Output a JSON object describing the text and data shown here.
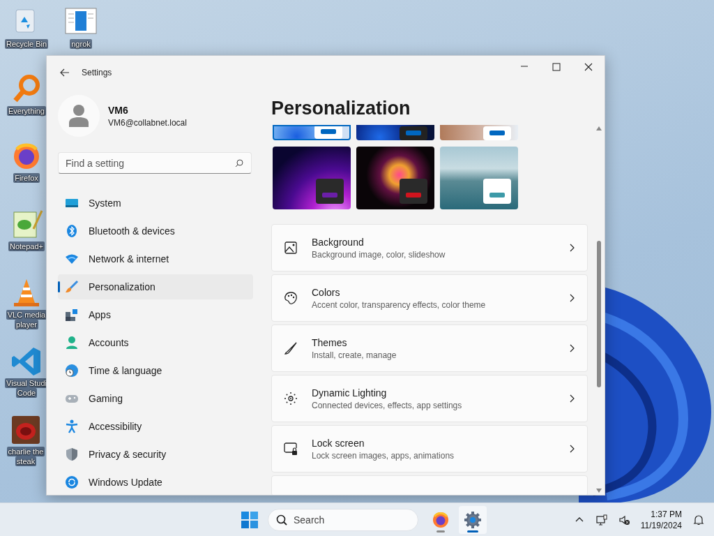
{
  "desktop_icons": [
    {
      "label": [
        "Recycle Bin"
      ]
    },
    {
      "label": [
        "ngrok"
      ]
    },
    {
      "label": [
        "Everything"
      ]
    },
    {
      "label": [
        "Firefox"
      ]
    },
    {
      "label": [
        "Notepad+"
      ]
    },
    {
      "label": [
        "VLC media",
        "player"
      ]
    },
    {
      "label": [
        "Visual Studi",
        "Code"
      ]
    },
    {
      "label": [
        "charlie the",
        "steak"
      ]
    }
  ],
  "window": {
    "title": "Settings"
  },
  "profile": {
    "name": "VM6",
    "email": "VM6@collabnet.local"
  },
  "search": {
    "placeholder": "Find a setting"
  },
  "sidebar": {
    "items": [
      {
        "label": "System",
        "selected": false
      },
      {
        "label": "Bluetooth & devices",
        "selected": false
      },
      {
        "label": "Network & internet",
        "selected": false
      },
      {
        "label": "Personalization",
        "selected": true
      },
      {
        "label": "Apps",
        "selected": false
      },
      {
        "label": "Accounts",
        "selected": false
      },
      {
        "label": "Time & language",
        "selected": false
      },
      {
        "label": "Gaming",
        "selected": false
      },
      {
        "label": "Accessibility",
        "selected": false
      },
      {
        "label": "Privacy & security",
        "selected": false
      },
      {
        "label": "Windows Update",
        "selected": false
      }
    ]
  },
  "page": {
    "title": "Personalization"
  },
  "themes": [
    {
      "selected": true,
      "color": "#0067c0"
    },
    {
      "selected": false,
      "color": "#0067c0"
    },
    {
      "selected": false,
      "color": "#0067c0"
    },
    {
      "selected": false,
      "color": "#6b1fa8"
    },
    {
      "selected": false,
      "color": "#d0141e"
    },
    {
      "selected": false,
      "color": "#3d9aa8"
    }
  ],
  "settings": [
    {
      "title": "Background",
      "subtitle": "Background image, color, slideshow"
    },
    {
      "title": "Colors",
      "subtitle": "Accent color, transparency effects, color theme"
    },
    {
      "title": "Themes",
      "subtitle": "Install, create, manage"
    },
    {
      "title": "Dynamic Lighting",
      "subtitle": "Connected devices, effects, app settings"
    },
    {
      "title": "Lock screen",
      "subtitle": "Lock screen images, apps, animations"
    }
  ],
  "taskbar": {
    "search_placeholder": "Search",
    "apps": [
      {
        "selected": false
      },
      {
        "selected": true
      }
    ],
    "time": "1:37 PM",
    "date": "11/19/2024"
  }
}
